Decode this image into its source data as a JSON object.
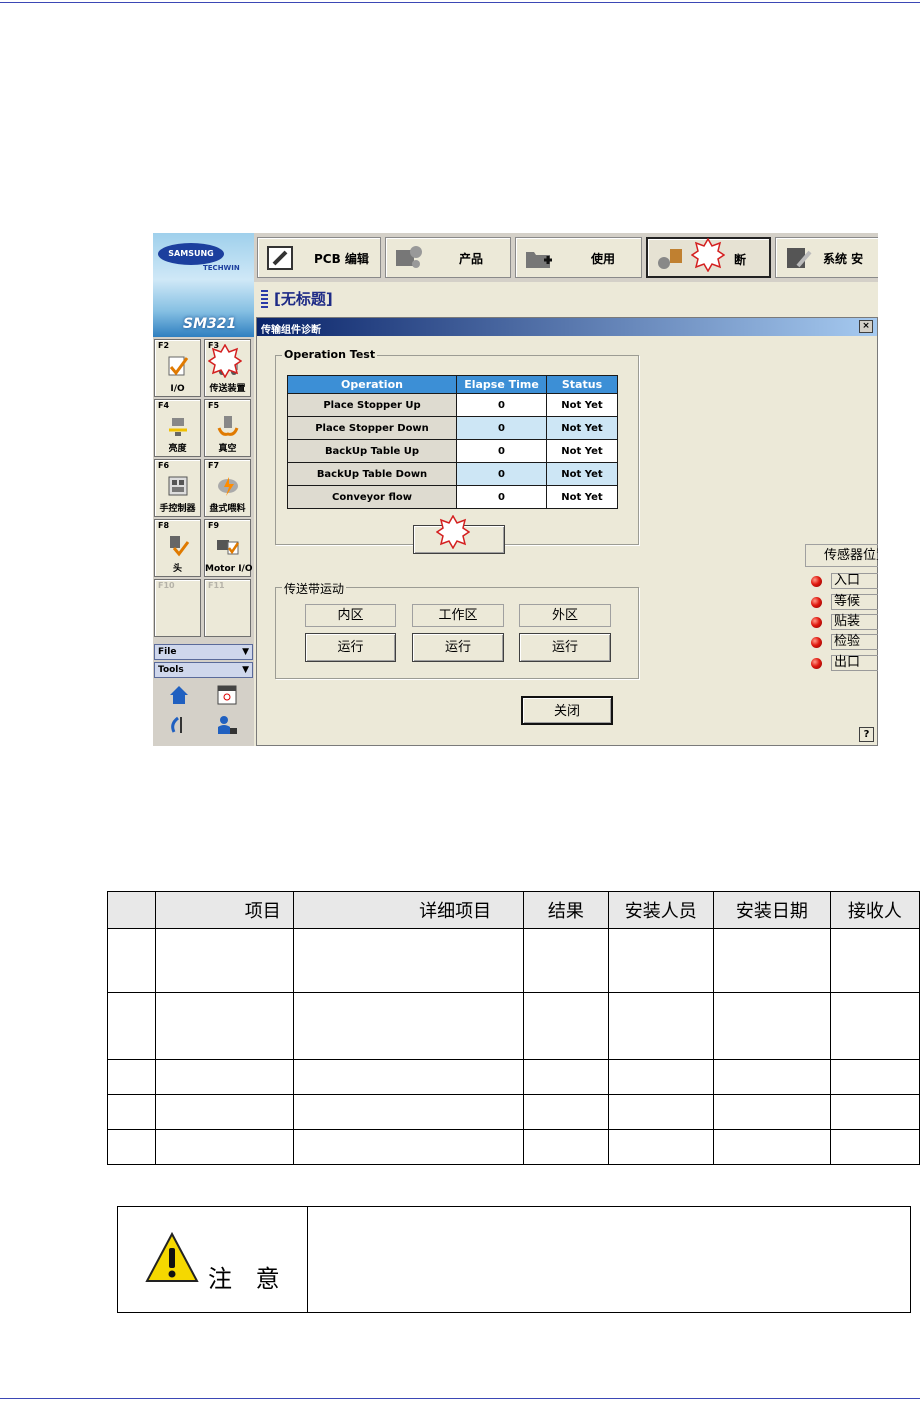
{
  "app": {
    "logo_brand": "SAMSUNG",
    "logo_sub": "TECHWIN",
    "model": "SM321",
    "window_title": "[无标题]"
  },
  "top_tabs": [
    {
      "label": "PCB 编辑",
      "icon": "pcb-edit-icon"
    },
    {
      "label": "产品",
      "icon": "gears-icon"
    },
    {
      "label": "使用",
      "icon": "folder-add-icon"
    },
    {
      "label": "断",
      "icon": "diagnose-icon",
      "active": true
    },
    {
      "label": "系统 安",
      "icon": "system-settings-icon"
    }
  ],
  "fkeys": [
    {
      "code": "F2",
      "label": "I/O"
    },
    {
      "code": "F3",
      "label": "传送装置"
    },
    {
      "code": "F4",
      "label": "亮度"
    },
    {
      "code": "F5",
      "label": "真空"
    },
    {
      "code": "F6",
      "label": "手控制器"
    },
    {
      "code": "F7",
      "label": "盘式喂料"
    },
    {
      "code": "F8",
      "label": "头"
    },
    {
      "code": "F9",
      "label": "Motor I/O"
    },
    {
      "code": "F10",
      "label": ""
    },
    {
      "code": "F11",
      "label": ""
    }
  ],
  "menus": {
    "file": "File",
    "tools": "Tools"
  },
  "dialog": {
    "title": "传输组件诊断",
    "close_glyph": "×",
    "operation_group_label": "Operation Test",
    "table_headers": [
      "Operation",
      "Elapse Time",
      "Status"
    ],
    "rows": [
      {
        "operation": "Place Stopper Up",
        "elapse": "0",
        "status": "Not Yet"
      },
      {
        "operation": "Place Stopper Down",
        "elapse": "0",
        "status": "Not Yet"
      },
      {
        "operation": "BackUp Table Up",
        "elapse": "0",
        "status": "Not Yet"
      },
      {
        "operation": "BackUp Table Down",
        "elapse": "0",
        "status": "Not Yet"
      },
      {
        "operation": "Conveyor flow",
        "elapse": "0",
        "status": "Not Yet"
      }
    ],
    "start_button_label": "",
    "conveyor_group_label": "传送带运动",
    "zones": [
      {
        "name": "内区",
        "run": "运行"
      },
      {
        "name": "工作区",
        "run": "运行"
      },
      {
        "name": "外区",
        "run": "运行"
      }
    ],
    "sensor_title": "传感器位置",
    "sensors": [
      "入口",
      "等候",
      "贴装",
      "检验",
      "出口"
    ],
    "sensor_led_color": "#e01a10",
    "close_button": "关闭",
    "help_glyph": "?"
  },
  "install_table": {
    "headers": [
      "",
      "项目",
      "详细项目",
      "结果",
      "安装人员",
      "安装日期",
      "接收人"
    ],
    "rows": [
      [
        "",
        "",
        "",
        "",
        "",
        "",
        ""
      ],
      [
        "",
        "",
        "",
        "",
        "",
        "",
        ""
      ],
      [
        "",
        "",
        "",
        "",
        "",
        "",
        ""
      ],
      [
        "",
        "",
        "",
        "",
        "",
        "",
        ""
      ],
      [
        "",
        "",
        "",
        "",
        "",
        "",
        ""
      ]
    ]
  },
  "caution": {
    "label": "注 意",
    "text": ""
  },
  "colors": {
    "header_blue": "#3c8fd6",
    "title_blue": "#1e2b86",
    "dialog_bg": "#ece9d8"
  }
}
